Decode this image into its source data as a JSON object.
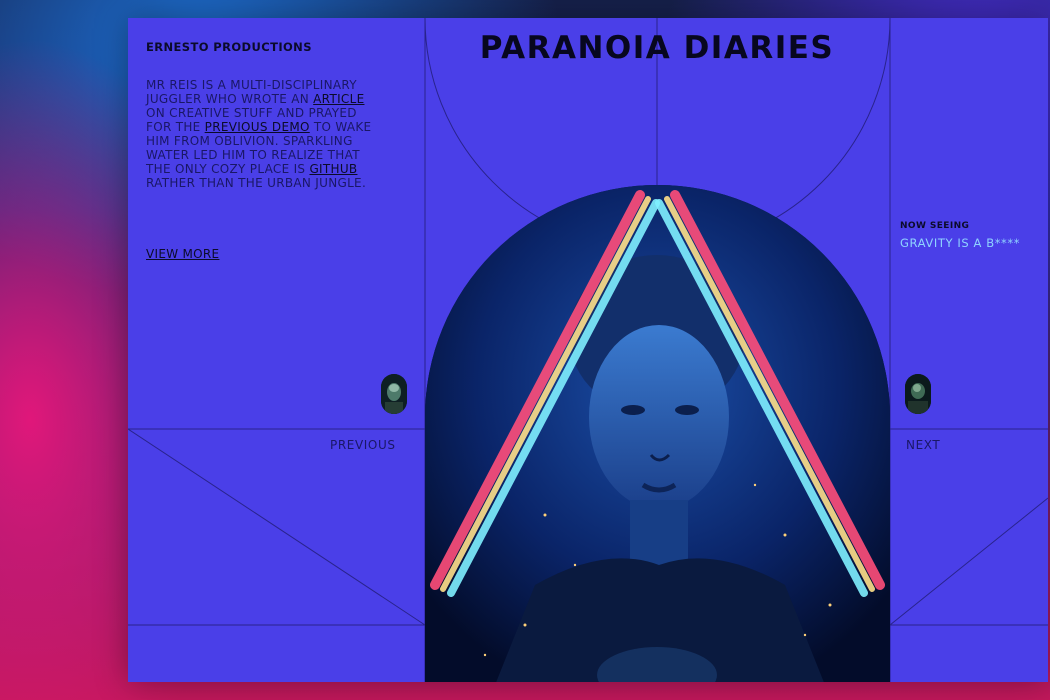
{
  "brand": "ERNESTO PRODUCTIONS",
  "title": "PARANOIA DIARIES",
  "bio": {
    "part1": "MR REIS IS A MULTI-DISCIPLINARY JUGGLER WHO WROTE AN ",
    "article_link": "ARTICLE",
    "part2": " ON CREATIVE STUFF AND PRAYED FOR THE ",
    "demo_link": "PREVIOUS DEMO",
    "part3": " TO WAKE HIM FROM OBLIVION. SPARKLING WATER LED HIM TO REALIZE THAT THE ONLY COZY PLACE IS ",
    "github_link": "GITHUB",
    "part4": " RATHER THAN THE URBAN JUNGLE."
  },
  "view_more": "VIEW MORE",
  "now_seeing": {
    "label": "NOW SEEING",
    "title": "GRAVITY IS A B****"
  },
  "nav": {
    "previous": "PREVIOUS",
    "next": "NEXT"
  },
  "colors": {
    "background_pink": "#e0177a",
    "panel_blue": "#4a3fe8",
    "text_dark": "#0b0b2a",
    "accent_cyan": "#8fd3ff"
  }
}
